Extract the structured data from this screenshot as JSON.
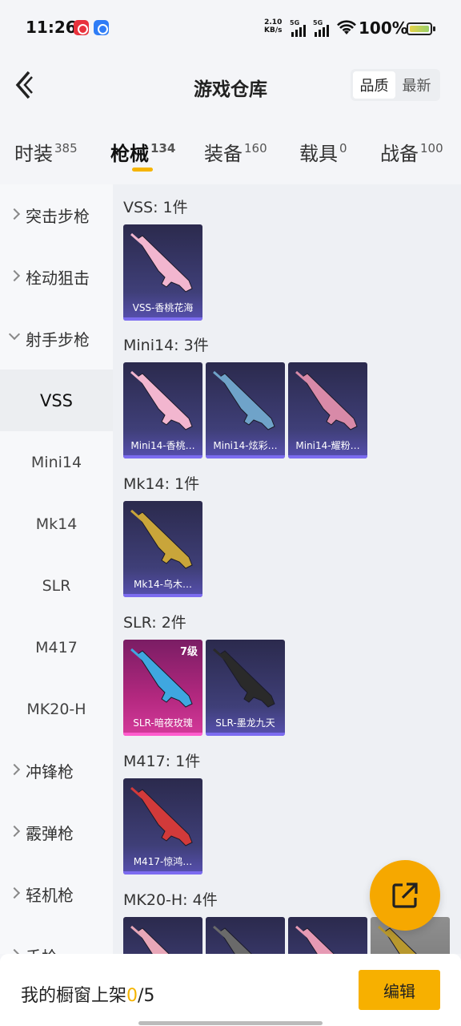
{
  "status_bar": {
    "time": "11:26",
    "net_speed_value": "2.10",
    "net_speed_unit": "KB/s",
    "sim1": "5G",
    "sim2": "5G",
    "battery": "100%"
  },
  "header": {
    "title": "游戏仓库",
    "sort_options": [
      "品质",
      "最新"
    ],
    "sort_selected": "品质"
  },
  "tabs": [
    {
      "label": "时装",
      "count": "385"
    },
    {
      "label": "枪械",
      "count": "134"
    },
    {
      "label": "装备",
      "count": "160"
    },
    {
      "label": "载具",
      "count": "0"
    },
    {
      "label": "战备",
      "count": "100"
    }
  ],
  "active_tab": "枪械",
  "sidebar": {
    "items": [
      {
        "label": "突击步枪",
        "kind": "category"
      },
      {
        "label": "栓动狙击",
        "kind": "category"
      },
      {
        "label": "射手步枪",
        "kind": "category-open"
      },
      {
        "label": "VSS",
        "kind": "sub-selected"
      },
      {
        "label": "Mini14",
        "kind": "sub"
      },
      {
        "label": "Mk14",
        "kind": "sub"
      },
      {
        "label": "SLR",
        "kind": "sub"
      },
      {
        "label": "M417",
        "kind": "sub"
      },
      {
        "label": "MK20-H",
        "kind": "sub"
      },
      {
        "label": "冲锋枪",
        "kind": "category"
      },
      {
        "label": "霰弹枪",
        "kind": "category"
      },
      {
        "label": "轻机枪",
        "kind": "category"
      },
      {
        "label": "手枪",
        "kind": "category"
      }
    ]
  },
  "groups": [
    {
      "title": "VSS: 1件",
      "items": [
        {
          "caption": "VSS-香桃花海",
          "style": "purple",
          "weapon_color": "#f2b6cf"
        }
      ]
    },
    {
      "title": "Mini14: 3件",
      "items": [
        {
          "caption": "Mini14-香桃…",
          "style": "purple",
          "weapon_color": "#f2b6cf"
        },
        {
          "caption": "Mini14-炫彩…",
          "style": "purple",
          "weapon_color": "#6fa3c9"
        },
        {
          "caption": "Mini14-耀粉…",
          "style": "purple",
          "weapon_color": "#d88aa8"
        }
      ]
    },
    {
      "title": "Mk14: 1件",
      "items": [
        {
          "caption": "Mk14-乌木…",
          "style": "purple",
          "weapon_color": "#c9a53a"
        }
      ]
    },
    {
      "title": "SLR: 2件",
      "items": [
        {
          "caption": "SLR-暗夜玫瑰",
          "style": "pink",
          "level": "7级",
          "weapon_color": "#3fa7e0"
        },
        {
          "caption": "SLR-墨龙九天",
          "style": "purple",
          "weapon_color": "#2a2a2a"
        }
      ]
    },
    {
      "title": "M417: 1件",
      "items": [
        {
          "caption": "M417-惊鸿…",
          "style": "purple",
          "weapon_color": "#d23a3a"
        }
      ]
    },
    {
      "title": "MK20-H: 4件",
      "items": [
        {
          "caption": "",
          "style": "purple",
          "weapon_color": "#e8a7b8"
        },
        {
          "caption": "",
          "style": "purple",
          "weapon_color": "#6a6a6a"
        },
        {
          "caption": "",
          "style": "purple",
          "weapon_color": "#e69ab4"
        },
        {
          "caption": "",
          "style": "gray",
          "weapon_color": "#b8982e"
        }
      ]
    }
  ],
  "bottom_bar": {
    "shelf_label": "我的橱窗上架",
    "shelf_current": "0",
    "shelf_total": "/5",
    "edit_label": "编辑"
  },
  "colors": {
    "accent": "#f5b400",
    "card_purple": "#3f3f78",
    "card_pink": "#b3287f"
  }
}
